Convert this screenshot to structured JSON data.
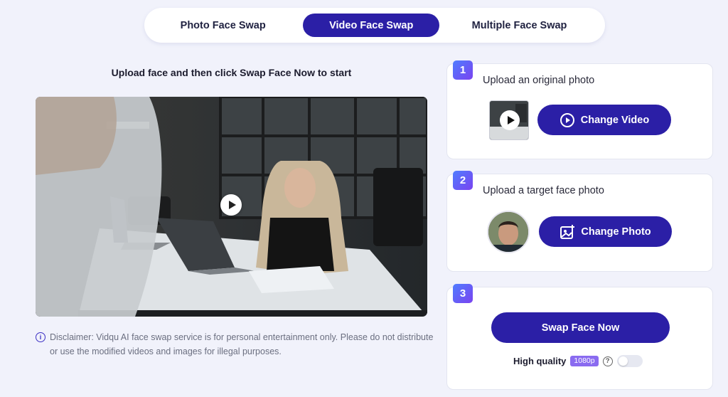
{
  "tabs": [
    {
      "label": "Photo Face Swap",
      "active": false
    },
    {
      "label": "Video Face Swap",
      "active": true
    },
    {
      "label": "Multiple Face Swap",
      "active": false
    }
  ],
  "left": {
    "heading": "Upload face and then click Swap Face Now to start",
    "disclaimer": "Disclaimer: Vidqu AI face swap service is for personal entertainment only. Please do not distribute or use the modified videos and images for illegal purposes."
  },
  "steps": [
    {
      "number": "1",
      "title": "Upload an original photo",
      "button_label": "Change Video",
      "button_icon": "play-circle-icon"
    },
    {
      "number": "2",
      "title": "Upload a target face photo",
      "button_label": "Change Photo",
      "button_icon": "image-upload-icon"
    },
    {
      "number": "3",
      "button_label": "Swap Face Now",
      "quality_label": "High quality",
      "quality_badge": "1080p",
      "quality_toggle_on": false
    }
  ],
  "colors": {
    "accent": "#2b1fa6",
    "badge_gradient_start": "#4f7dff",
    "badge_gradient_end": "#7a42f0",
    "background": "#f1f2fb"
  }
}
